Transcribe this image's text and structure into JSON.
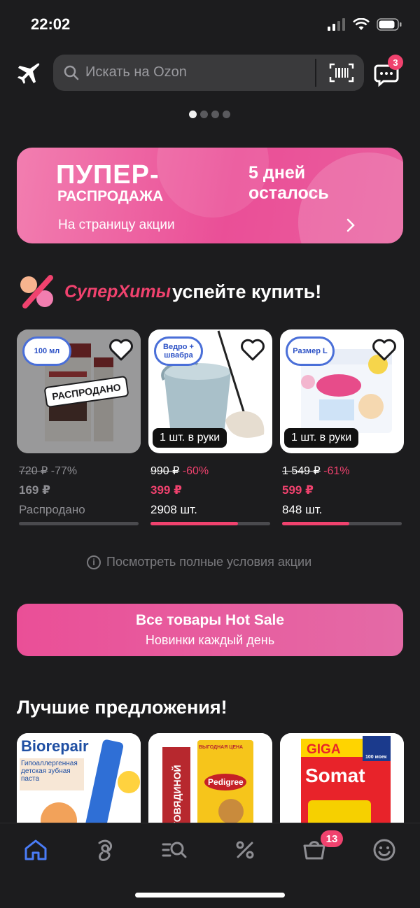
{
  "status": {
    "time": "22:02"
  },
  "header": {
    "search_placeholder": "Искать на Ozon",
    "chat_badge": "3"
  },
  "banner": {
    "title": "ПУПЕР-",
    "subtitle": "РАСПРОДАЖА",
    "days_line1": "5 дней",
    "days_line2": "осталось",
    "link": "На страницу акции"
  },
  "hits": {
    "brand": "СуперХиты",
    "title": "успейте купить!"
  },
  "products": [
    {
      "tag": "100 мл",
      "stamp": "РАСПРОДАНО",
      "old_price": "720 ₽",
      "discount": "-77%",
      "price": "169 ₽",
      "qty": "Распродано",
      "progress": 0
    },
    {
      "tag": "Ведро + швабра",
      "pill": "1 шт. в руки",
      "old_price": "990 ₽",
      "discount": "-60%",
      "price": "399 ₽",
      "qty": "2908 шт.",
      "progress": 0.73
    },
    {
      "tag": "Размер L",
      "pill": "1 шт. в руки",
      "old_price": "1 549 ₽",
      "discount": "-61%",
      "price": "599 ₽",
      "qty": "848 шт.",
      "progress": 0.56
    }
  ],
  "terms": {
    "icon": "i",
    "label": "Посмотреть полные условия акции"
  },
  "hotsale": {
    "title": "Все товары Hot Sale",
    "subtitle": "Новинки каждый день"
  },
  "best": {
    "title": "Лучшие предложения!",
    "items": [
      {
        "brand": "Biorepair",
        "text": "Гипоаллергенная детская зубная паста"
      },
      {
        "brand": "Pedigree",
        "text": "ГОВЯДИНОЙ",
        "tag": "ВЫГОДНАЯ ЦЕНА"
      },
      {
        "brand": "Somat",
        "text": "GIGA",
        "badge": "100 моек"
      }
    ]
  },
  "tabbar": {
    "cart_badge": "13"
  },
  "colors": {
    "accent": "#f0426e",
    "background": "#1c1c1e",
    "active_tab": "#4a7cf7"
  },
  "icons": [
    "plane-icon",
    "search-icon",
    "barcode-icon",
    "chat-icon",
    "heart-icon",
    "chevron-right-icon",
    "info-icon",
    "home-icon",
    "fresh-icon",
    "catalog-search-icon",
    "percent-icon",
    "cart-icon",
    "profile-icon"
  ]
}
